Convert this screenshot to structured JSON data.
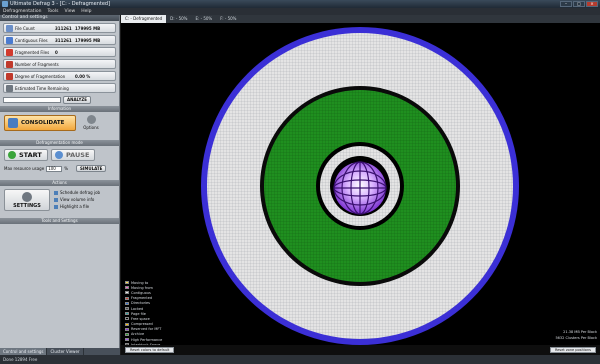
{
  "window": {
    "title": "Ultimate Defrag 3 - [C: - Defragmented]",
    "controls": [
      "–",
      "□",
      "×"
    ]
  },
  "menu": [
    "Defragmentation",
    "Tools",
    "View",
    "Help"
  ],
  "left_panel": {
    "header": "Control and settings",
    "stats": [
      {
        "label": "File Count",
        "value": "311261",
        "size": "179995 MB",
        "icon": "files-icon",
        "color": "#6b8fc8"
      },
      {
        "label": "Contiguous Files",
        "value": "311261",
        "size": "179995 MB",
        "icon": "contiguous-icon",
        "color": "#4b7bd0"
      },
      {
        "label": "Fragmented Files",
        "value": "0",
        "size": "",
        "icon": "fragmented-icon",
        "color": "#d23b2e"
      },
      {
        "label": "Number of Fragments",
        "value": "",
        "size": "",
        "icon": "fragments-icon",
        "color": "#c0392b"
      },
      {
        "label": "Degree of Fragmentation",
        "value": "",
        "size": "0.00 %",
        "icon": "degree-icon",
        "color": "#c0392b"
      },
      {
        "label": "Estimated Time Remaining",
        "value": "",
        "size": "",
        "icon": "clock-icon",
        "color": "#6f7780"
      }
    ],
    "analyze_label": "ANALYZE",
    "information_caption": "Information",
    "consolidate_label": "CONSOLIDATE",
    "options_label": "Options",
    "defrag_mode_caption": "Defragmentation mode",
    "start_label": "START",
    "pause_label": "PAUSE",
    "resource_label": "Max resource usage",
    "resource_value": "100",
    "resource_unit": "%",
    "simulate_label": "SIMULATE",
    "actions_caption": "Actions",
    "settings_label": "SETTINGS",
    "links": [
      "Schedule defrag job",
      "View volume info",
      "Highlight a file"
    ],
    "tools_caption": "Tools and Settings"
  },
  "bottom_tabs": [
    "Control and settings",
    "Cluster Viewer"
  ],
  "status_text": "Done  12894 Free",
  "drive_tabs": [
    "C: - Defragmented",
    "D: - 50%",
    "E: - 50%",
    "F: - 50%"
  ],
  "legend": [
    {
      "label": "Moving to",
      "color": "#ffe14a"
    },
    {
      "label": "Moving from",
      "color": "#ff66cc"
    },
    {
      "label": "Contiguous",
      "color": "#e6e6e6"
    },
    {
      "label": "Fragmented",
      "color": "#d23b2e"
    },
    {
      "label": "Directories",
      "color": "#2f6fd0"
    },
    {
      "label": "Locked",
      "color": "#444444"
    },
    {
      "label": "Page file",
      "color": "#2aa2a2"
    },
    {
      "label": "Free space",
      "color": "#000000"
    },
    {
      "label": "Compressed",
      "color": "#ffc000"
    },
    {
      "label": "Reserved for MFT",
      "color": "#8a2be2"
    },
    {
      "label": "Archive",
      "color": "#1f9b1f"
    },
    {
      "label": "High Performance",
      "color": "#a64dff"
    },
    {
      "label": "Interblock Space",
      "color": "#555555"
    }
  ],
  "scale": {
    "line1": "21.38 MB Per Block",
    "line2": "5632 Clusters Per Block"
  },
  "buttons": {
    "reset_colors": "Reset colors to default",
    "reset_zone": "Reset zone positions"
  },
  "colors": {
    "outer_ring": "#e4e4e4",
    "outer_border": "#3b2fd6",
    "archive_ring": "#1f8f1f",
    "center": "#a64dff"
  }
}
